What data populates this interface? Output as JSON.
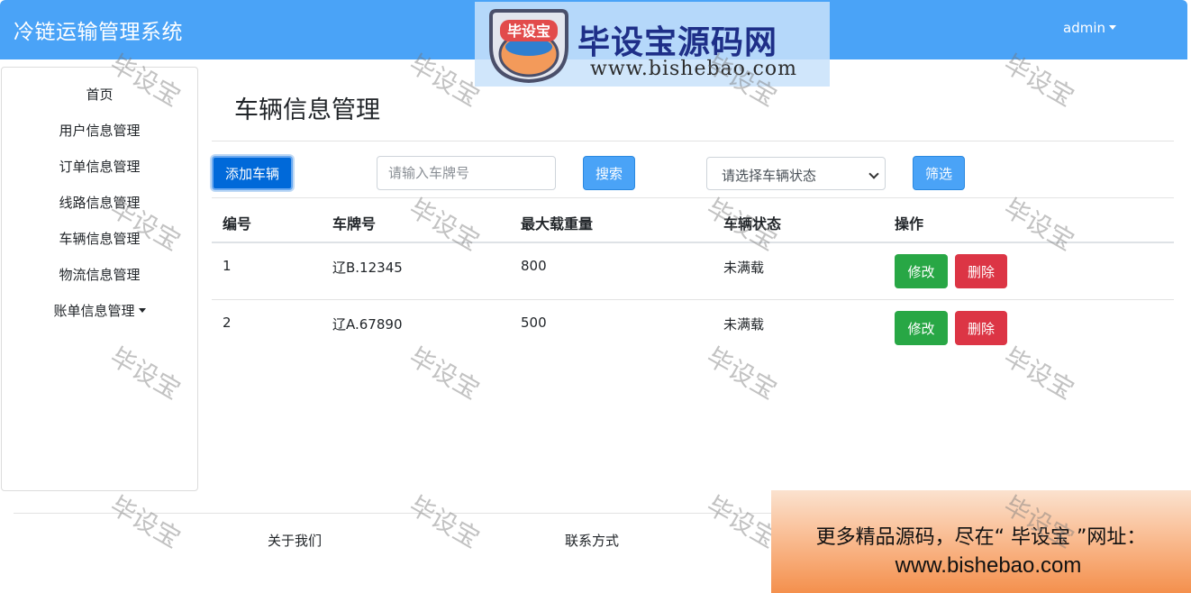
{
  "navbar": {
    "brand": "冷链运输管理系统",
    "user": "admin"
  },
  "logo_banner": {
    "badge_text": "毕设宝",
    "title": "毕设宝源码网",
    "url": "www.bishebao.com"
  },
  "sidebar": {
    "items": [
      {
        "label": "首页"
      },
      {
        "label": "用户信息管理"
      },
      {
        "label": "订单信息管理"
      },
      {
        "label": "线路信息管理"
      },
      {
        "label": "车辆信息管理"
      },
      {
        "label": "物流信息管理"
      },
      {
        "label": "账单信息管理"
      }
    ]
  },
  "main": {
    "title": "车辆信息管理",
    "add_button": "添加车辆",
    "search_placeholder": "请输入车牌号",
    "search_button": "搜索",
    "status_select": "请选择车辆状态",
    "filter_button": "筛选"
  },
  "table": {
    "headers": [
      "编号",
      "车牌号",
      "最大载重量",
      "车辆状态",
      "操作"
    ],
    "rows": [
      {
        "id": "1",
        "plate": "辽B.12345",
        "max_load": "800",
        "status": "未满载"
      },
      {
        "id": "2",
        "plate": "辽A.67890",
        "max_load": "500",
        "status": "未满载"
      }
    ],
    "edit_label": "修改",
    "delete_label": "删除"
  },
  "footer": {
    "about": "关于我们",
    "contact": "联系方式"
  },
  "promo": {
    "line1": "更多精品源码，尽在“ 毕设宝 ”网址：",
    "line2": "www.bishebao.com"
  },
  "watermark": "毕设宝",
  "colors": {
    "navbar": "#4aa3f7",
    "primary": "#0069d9",
    "success": "#28a745",
    "danger": "#dc3545"
  }
}
